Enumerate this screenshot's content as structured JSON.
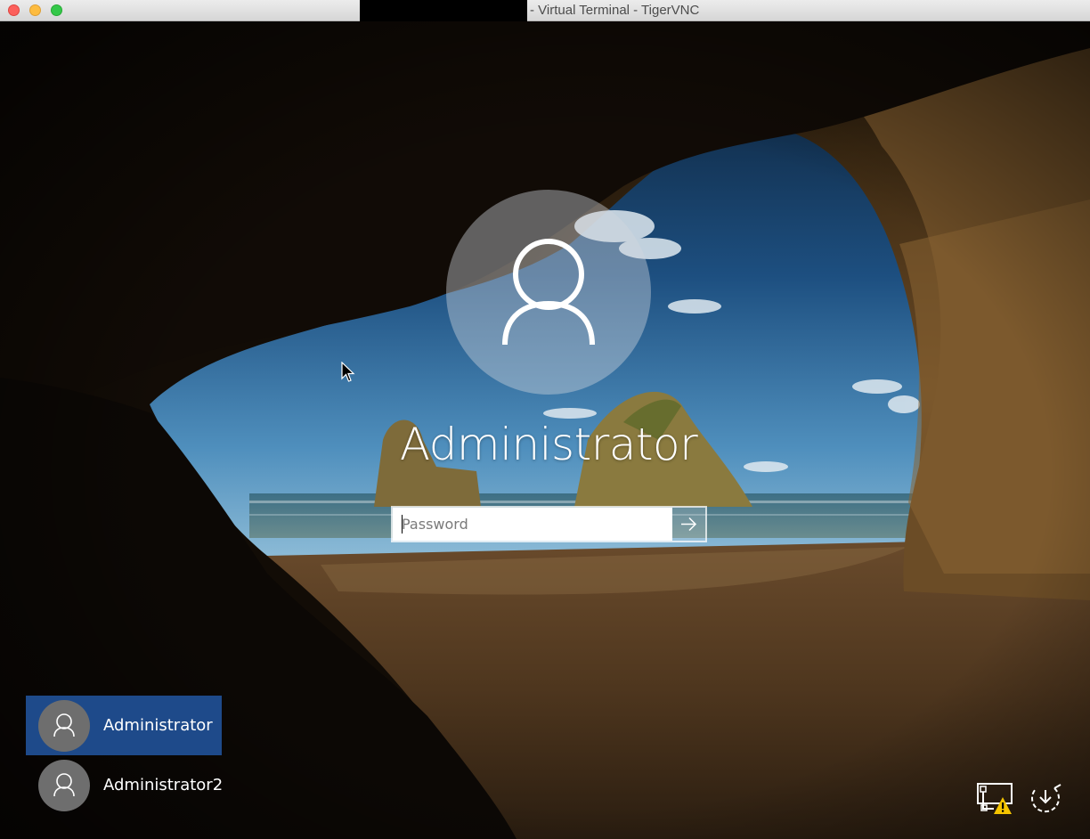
{
  "window": {
    "title": "- Virtual Terminal - TigerVNC",
    "controls": [
      "close",
      "minimize",
      "zoom"
    ]
  },
  "login": {
    "username": "Administrator",
    "password_placeholder": "Password",
    "password_value": "",
    "submit_icon": "arrow-right-icon"
  },
  "user_list": [
    {
      "name": "Administrator",
      "selected": true,
      "icon": "user-icon"
    },
    {
      "name": "Administrator2",
      "selected": false,
      "icon": "user-icon"
    }
  ],
  "system_icons": {
    "network": "network-warning-icon",
    "power": "power-icon"
  },
  "colors": {
    "selected_user_bg": "#1e4a8a",
    "titlebar_bg": "#e4e4e4",
    "text": "#ffffff"
  }
}
